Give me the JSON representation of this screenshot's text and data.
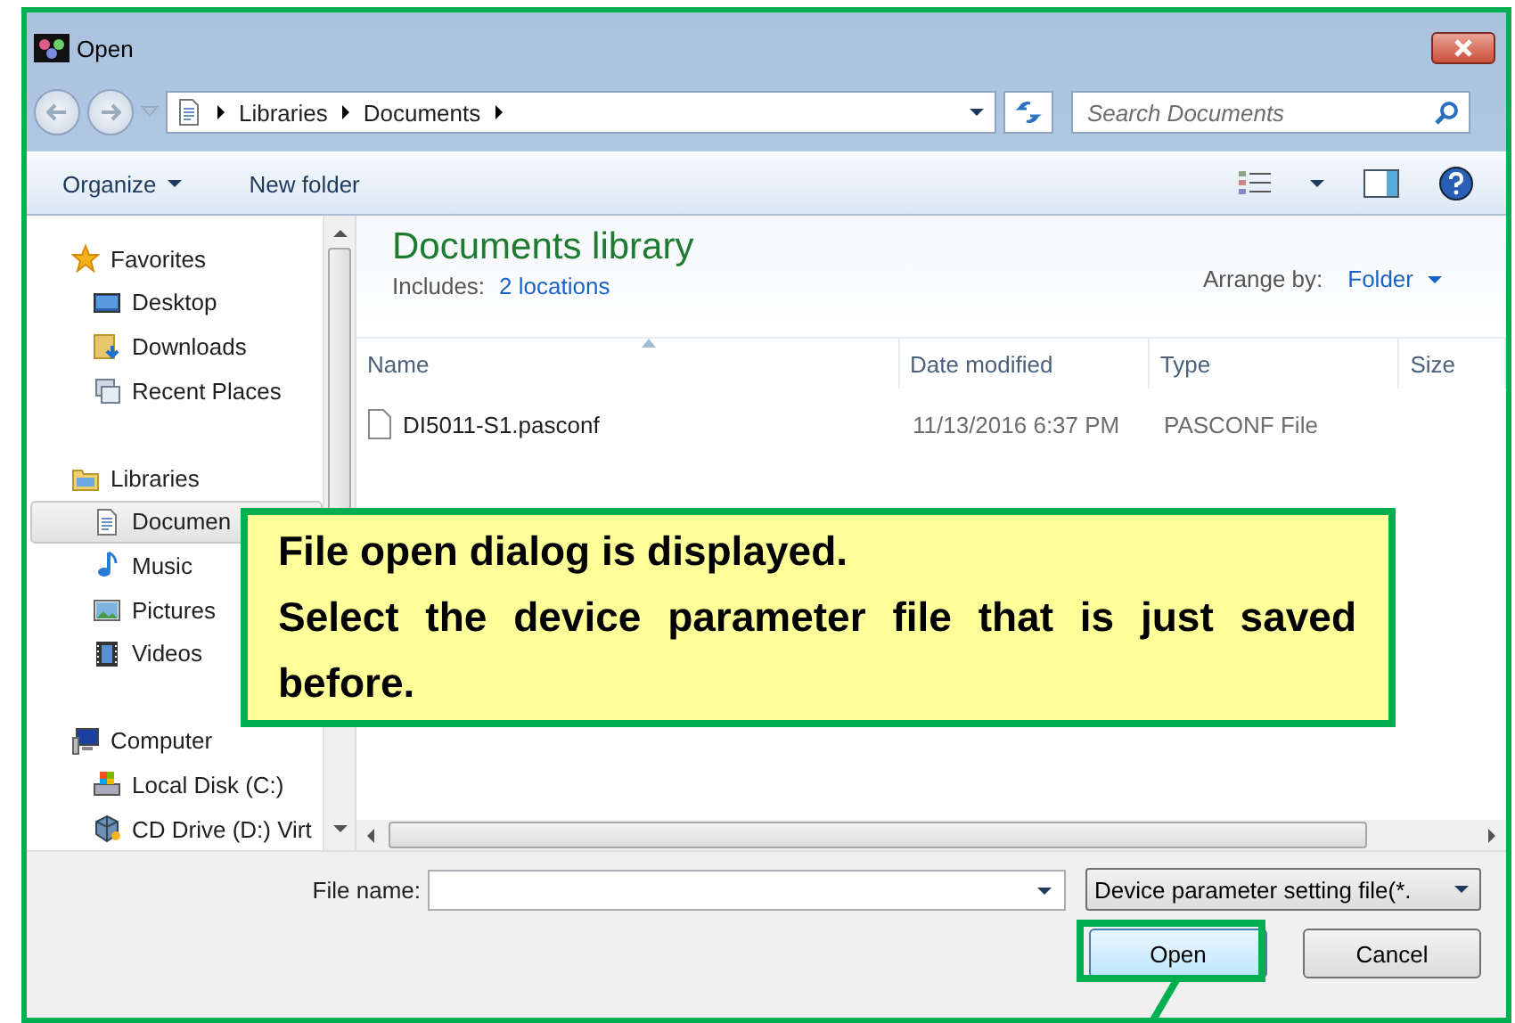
{
  "window": {
    "title": "Open"
  },
  "address": {
    "crumbs": [
      "Libraries",
      "Documents"
    ]
  },
  "search": {
    "placeholder": "Search Documents"
  },
  "toolbar": {
    "items": [
      {
        "label": "Organize",
        "kind": "menu"
      },
      {
        "label": "New folder",
        "kind": "button"
      }
    ]
  },
  "sidebar": {
    "items": [
      {
        "label": "Favorites",
        "kind": "star",
        "selected": false,
        "children": [
          {
            "label": "Desktop",
            "kind": "desktop",
            "selected": false
          },
          {
            "label": "Downloads",
            "kind": "downloads",
            "selected": false
          },
          {
            "label": "Recent Places",
            "kind": "recent",
            "selected": false
          }
        ]
      },
      {
        "label": "Libraries",
        "kind": "library",
        "selected": false,
        "children": [
          {
            "label": "Documen",
            "kind": "documents",
            "selected": true
          },
          {
            "label": "Music",
            "kind": "music",
            "selected": false
          },
          {
            "label": "Pictures",
            "kind": "pictures",
            "selected": false
          },
          {
            "label": "Videos",
            "kind": "videos",
            "selected": false
          }
        ]
      },
      {
        "label": "Computer",
        "kind": "computer",
        "selected": false,
        "children": [
          {
            "label": "Local Disk (C:)",
            "kind": "disk",
            "selected": false
          },
          {
            "label": "CD Drive (D:) Virt",
            "kind": "cd",
            "selected": false
          }
        ]
      }
    ]
  },
  "library": {
    "title": "Documents library",
    "includes_label": "Includes:",
    "includes_link": "2 locations",
    "arrange_label": "Arrange by:",
    "arrange_value": "Folder"
  },
  "table": {
    "columns": [
      "Name",
      "Date modified",
      "Type",
      "Size"
    ],
    "rows": [
      {
        "name": "DI5011-S1.pasconf",
        "date": "11/13/2016 6:37 PM",
        "type": "PASCONF File",
        "selected": false
      }
    ]
  },
  "bottom": {
    "file_name_label": "File name:",
    "file_type": "Device parameter setting file(*.",
    "buttons": [
      {
        "label": "Open",
        "kind": "default"
      },
      {
        "label": "Cancel",
        "kind": "normal"
      }
    ]
  },
  "callout": {
    "lines": [
      "File open dialog is displayed.",
      "Select the device parameter file that is just saved before."
    ]
  }
}
